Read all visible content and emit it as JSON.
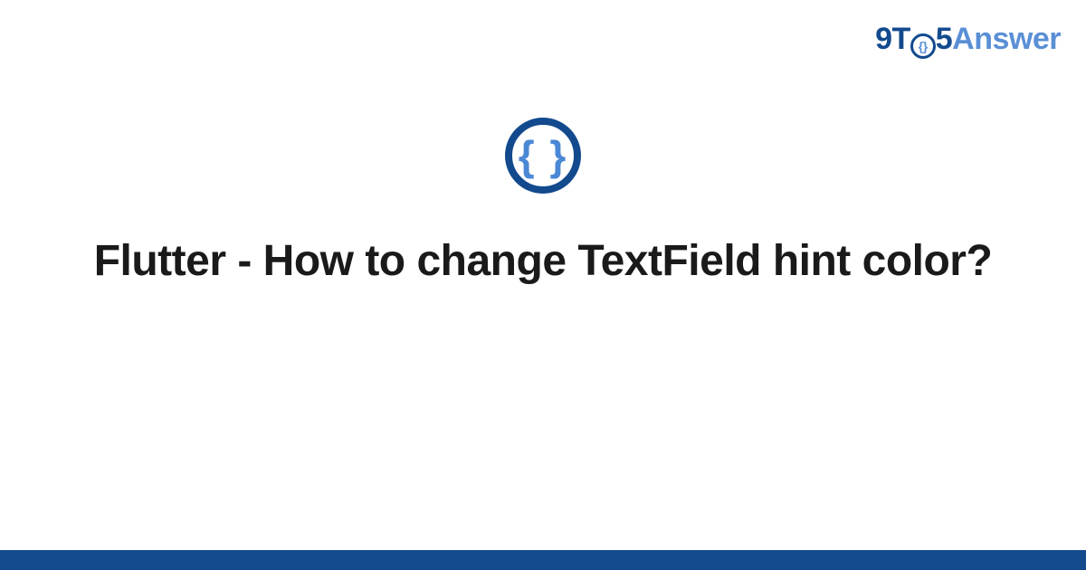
{
  "brand": {
    "part1": "9T",
    "o_brace": "{}",
    "part2": "5",
    "part3": "Answer"
  },
  "icon": {
    "brace": "{ }"
  },
  "title": "Flutter - How to change TextField hint color?",
  "colors": {
    "primary": "#134a8e",
    "accent": "#5a8fd6",
    "brace": "#4a87d4"
  }
}
